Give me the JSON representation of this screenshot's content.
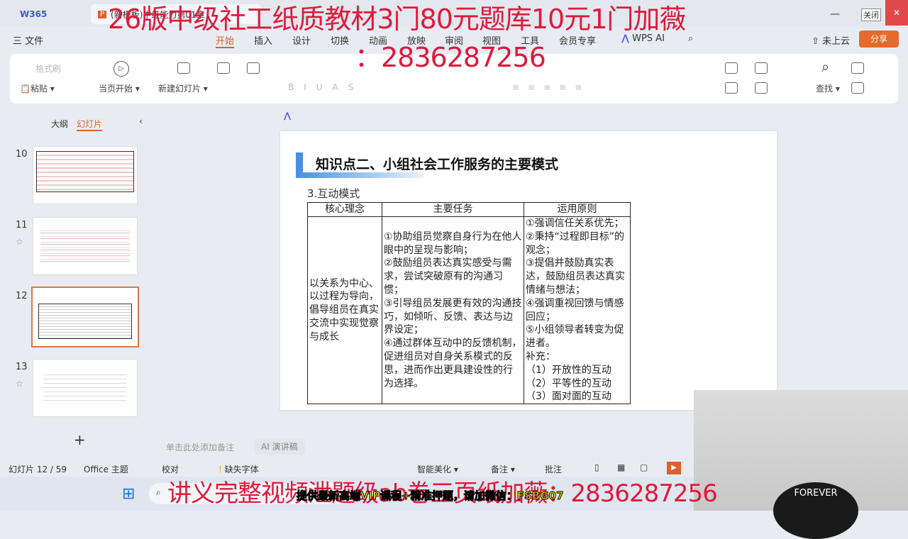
{
  "titlebar": {
    "home": "W365",
    "doc_tab": "(新模板)中级能力第01章",
    "close_tooltip": "关闭"
  },
  "menubar": {
    "file": "三 文件",
    "tabs": [
      "开始",
      "插入",
      "设计",
      "切换",
      "动画",
      "放映",
      "审阅",
      "视图",
      "工具",
      "会员专享"
    ],
    "wps_ai": "WPS AI",
    "cloud": "未上云",
    "share": "分享"
  },
  "ribbon": {
    "format_painter": "格式刷",
    "paste": "粘贴",
    "play_current": "当页开始",
    "new_slide": "新建幻灯片",
    "find": "查找"
  },
  "leftpane": {
    "tab_outline": "大纲",
    "tab_slides": "幻灯片",
    "slides": [
      {
        "num": "10"
      },
      {
        "num": "11"
      },
      {
        "num": "12"
      },
      {
        "num": "13"
      }
    ],
    "add": "+"
  },
  "slide": {
    "title": "知识点二、小组社会工作服务的主要模式",
    "subtitle": "3.互动模式",
    "headers": [
      "核心理念",
      "主要任务",
      "运用原则"
    ],
    "core": "以关系为中心、以过程为导向，倡导组员在真实交流中实现觉察与成长",
    "tasks": [
      "①协助组员觉察自身行为在他人眼中的呈现与影响；",
      "②鼓励组员表达真实感受与需求，尝试突破原有的沟通习惯；",
      "③引导组员发展更有效的沟通技巧，如倾听、反馈、表达与边界设定；",
      "④通过群体互动中的反馈机制，促进组员对自身关系模式的反思，进而作出更具建设性的行为选择。"
    ],
    "principles": [
      "①强调信任关系优先；",
      "②秉持“过程即目标”的观念；",
      "③提倡并鼓励真实表达，鼓励组员表达真实情绪与想法；",
      "④强调重视回馈与情感回应；",
      "⑤小组领导者转变为促进者。",
      "补充：",
      "（1）开放性的互动",
      "（2）平等性的互动",
      "（3）面对面的互动"
    ]
  },
  "notes": {
    "placeholder": "单击此处添加备注",
    "ai_speech": "AI 演讲稿"
  },
  "status": {
    "slide_count": "幻灯片 12 / 59",
    "theme": "Office 主题",
    "proof": "校对",
    "missing_font": "缺失字体",
    "beautify": "智能美化",
    "notes": "备注",
    "comments": "批注"
  },
  "overlay": {
    "top1": "26版中级社工纸质教材3门80元题库10元1门加薇",
    "top2": "：2836287256",
    "bottom": "讲义完整视频泄题级ab卷三页纸加薇：2836287256",
    "yellow": "提供最新高端VIP课程+精准押题，请加微信：FSBG07",
    "cam_text": "FOREVER"
  },
  "colors": {
    "accent": "#e0744a",
    "overlay_red": "#e0193c",
    "share": "#e66a2c"
  }
}
